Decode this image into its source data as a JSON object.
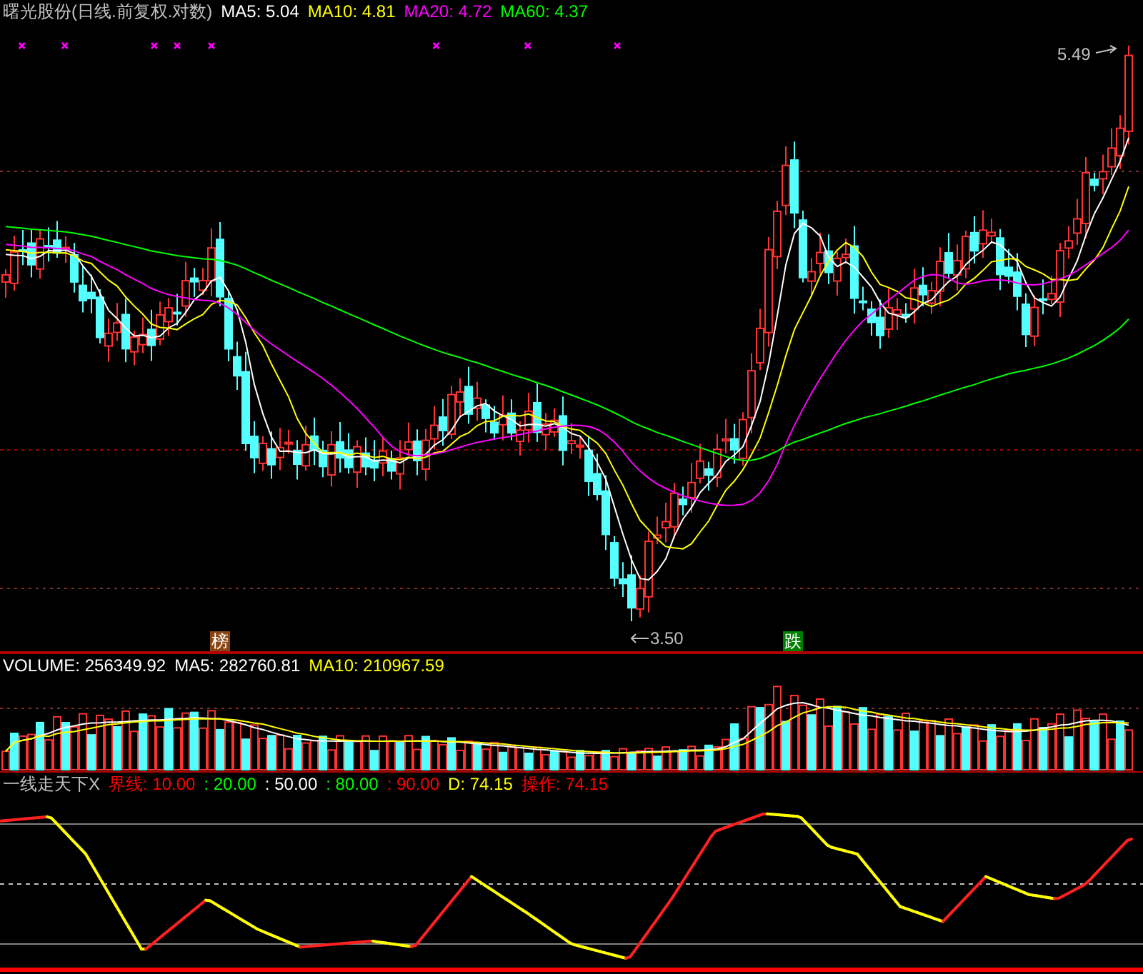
{
  "price_panel": {
    "title": "曙光股份(日线.前复权.对数)",
    "indicators": [
      {
        "label": "MA5: 5.04",
        "color": "#ffffff"
      },
      {
        "label": "MA10: 4.81",
        "color": "#ffff00"
      },
      {
        "label": "MA20: 4.72",
        "color": "#ff00ff"
      },
      {
        "label": "MA60: 4.37",
        "color": "#00ff00"
      }
    ],
    "high_label": "5.49",
    "low_label": "3.50",
    "signals": [
      {
        "text": "榜",
        "color": "#8b4513"
      },
      {
        "text": "跌",
        "color": "#008000"
      }
    ]
  },
  "volume_panel": {
    "indicators": [
      {
        "label": "VOLUME: 256349.92",
        "color": "#ffffff"
      },
      {
        "label": "MA5: 282760.81",
        "color": "#ffffff"
      },
      {
        "label": "MA10: 210967.59",
        "color": "#ffff00"
      }
    ]
  },
  "oscillator_panel": {
    "name": "一线走天下X",
    "indicators": [
      {
        "label": "界线: 10.00",
        "color": "#ff0000"
      },
      {
        "label": ": 20.00",
        "color": "#00ff00"
      },
      {
        "label": ": 50.00",
        "color": "#ffffff"
      },
      {
        "label": ": 80.00",
        "color": "#00ff00"
      },
      {
        "label": ": 90.00",
        "color": "#ff0000"
      },
      {
        "label": "D: 74.15",
        "color": "#ffff00"
      },
      {
        "label": "操作: 74.15",
        "color": "#ff0000"
      }
    ]
  }
}
